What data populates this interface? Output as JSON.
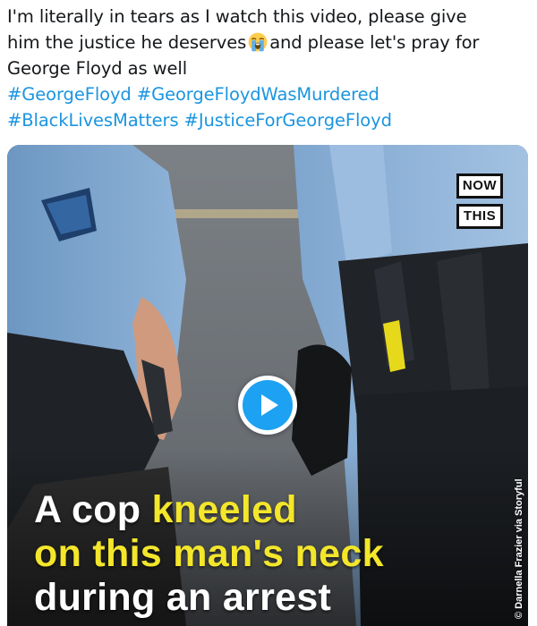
{
  "tweet": {
    "line1": "I'm literally in tears as I watch this video, please give",
    "line2_before_emoji": "him the justice he deserves",
    "emoji": "loudly-crying-face",
    "line2_after_emoji": "and please let's pray for",
    "line3": "George Floyd as well",
    "hashtags": {
      "georgefloyd": "#GeorgeFloyd",
      "murdered": "#GeorgeFloydWasMurdered",
      "blm": "#BlackLivesMatters",
      "justice": "#JusticeForGeorgeFloyd"
    },
    "hashtag_color": "#1b95e0",
    "text_color": "#14171a"
  },
  "video": {
    "logo_top": "NOW",
    "logo_bottom": "THIS",
    "play_icon": "play-icon",
    "play_color": "#1da1f2",
    "caption": {
      "line1_white": "A cop",
      "line1_yellow": "kneeled",
      "line2_yellow": "on this man's neck",
      "line3_white": "during an arrest",
      "highlight_color": "#f3e62b"
    },
    "credit": "© Darnella Frazier via Storyful"
  }
}
